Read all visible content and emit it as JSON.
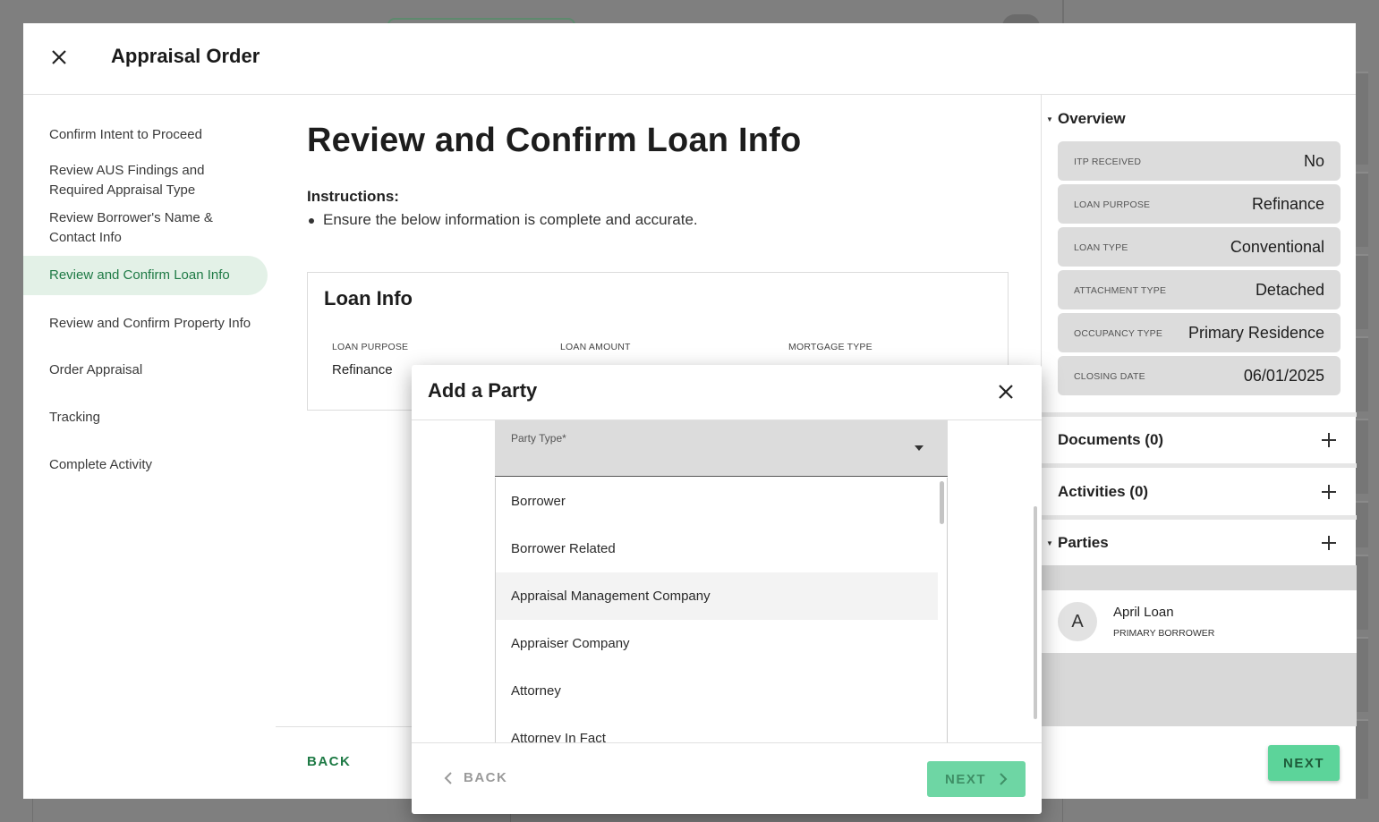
{
  "modal": {
    "title": "Appraisal Order"
  },
  "steps": [
    {
      "label": "Confirm Intent to Proceed"
    },
    {
      "label": "Review AUS Findings and Required Appraisal Type"
    },
    {
      "label": "Review Borrower's Name & Contact Info"
    },
    {
      "label": "Review and Confirm Loan Info",
      "active": true
    },
    {
      "label": "Review and Confirm Property Info"
    },
    {
      "label": "Order Appraisal"
    },
    {
      "label": "Tracking"
    },
    {
      "label": "Complete Activity"
    }
  ],
  "content": {
    "title": "Review and Confirm Loan Info",
    "instructions_label": "Instructions:",
    "instruction_item": "Ensure the below information is complete and accurate.",
    "loan_card": {
      "title": "Loan Info",
      "fields": [
        {
          "label": "LOAN PURPOSE",
          "value": "Refinance"
        },
        {
          "label": "LOAN AMOUNT",
          "value": ""
        },
        {
          "label": "MORTGAGE TYPE",
          "value": ""
        }
      ]
    },
    "back_label": "BACK"
  },
  "right_panel": {
    "overview_label": "Overview",
    "overview": [
      {
        "label": "ITP RECEIVED",
        "value": "No"
      },
      {
        "label": "LOAN PURPOSE",
        "value": "Refinance"
      },
      {
        "label": "LOAN TYPE",
        "value": "Conventional"
      },
      {
        "label": "ATTACHMENT TYPE",
        "value": "Detached"
      },
      {
        "label": "OCCUPANCY TYPE",
        "value": "Primary Residence"
      },
      {
        "label": "CLOSING DATE",
        "value": "06/01/2025"
      }
    ],
    "documents_label": "Documents (0)",
    "activities_label": "Activities (0)",
    "parties_label": "Parties",
    "party": {
      "initial": "A",
      "name": "April Loan",
      "role": "PRIMARY BORROWER"
    },
    "next_label": "NEXT"
  },
  "dialog": {
    "title": "Add a Party",
    "party_type_label": "Party Type*",
    "options": [
      "Borrower",
      "Borrower Related",
      "Appraisal Management Company",
      "Appraiser Company",
      "Attorney",
      "Attorney In Fact"
    ],
    "highlighted_option": "Appraisal Management Company",
    "back_label": "BACK",
    "next_label": "NEXT"
  },
  "colors": {
    "accent_green": "#1e7a45",
    "active_step_bg": "#e3f1e7",
    "next_button": "#5cd49a"
  }
}
